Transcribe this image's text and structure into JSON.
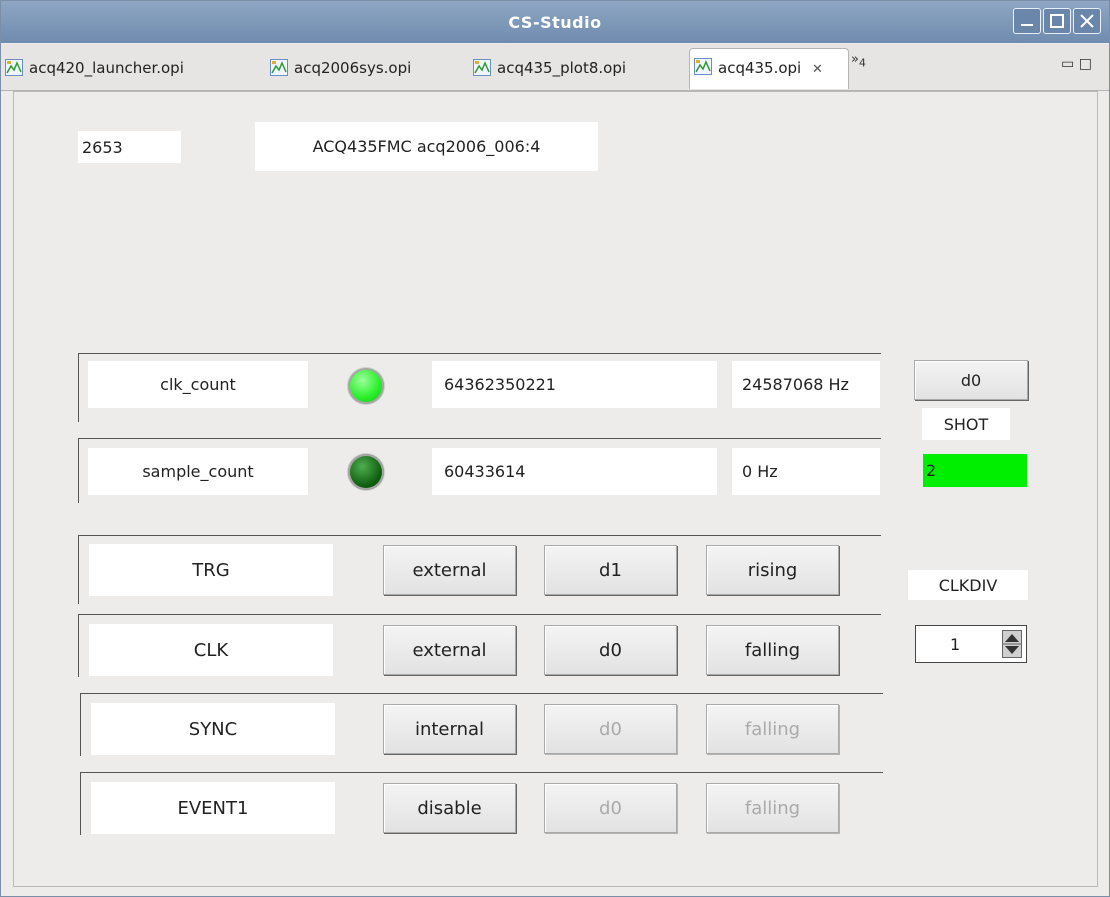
{
  "window": {
    "title": "CS-Studio"
  },
  "tabs": [
    {
      "label": "acq420_launcher.opi",
      "active": false
    },
    {
      "label": "acq2006sys.opi",
      "active": false
    },
    {
      "label": "acq435_plot8.opi",
      "active": false
    },
    {
      "label": "acq435.opi",
      "active": true
    }
  ],
  "tab_overflow": {
    "arrow": "»",
    "count": "4"
  },
  "header": {
    "id_value": "2653",
    "device_label": "ACQ435FMC acq2006_006:4"
  },
  "counters": [
    {
      "label": "clk_count",
      "count": "64362350221",
      "rate": "24587068 Hz",
      "led_color": "#27ef27",
      "led_state": "on"
    },
    {
      "label": "sample_count",
      "count": "60433614",
      "rate": "0 Hz",
      "led_color": "#0f5f0f",
      "led_state": "off"
    }
  ],
  "signals": [
    {
      "label": "TRG",
      "source": "external",
      "line": "d1",
      "edge": "rising",
      "enabled": true
    },
    {
      "label": "CLK",
      "source": "external",
      "line": "d0",
      "edge": "falling",
      "enabled": true
    },
    {
      "label": "SYNC",
      "source": "internal",
      "line": "d0",
      "edge": "falling",
      "enabled": false
    },
    {
      "label": "EVENT1",
      "source": "disable",
      "line": "d0",
      "edge": "falling",
      "enabled": false
    }
  ],
  "side": {
    "d0_button": "d0",
    "shot_label": "SHOT",
    "shot_value": "2",
    "shot_color": "#00ee00",
    "clkdiv_label": "CLKDIV",
    "clkdiv_value": "1"
  }
}
